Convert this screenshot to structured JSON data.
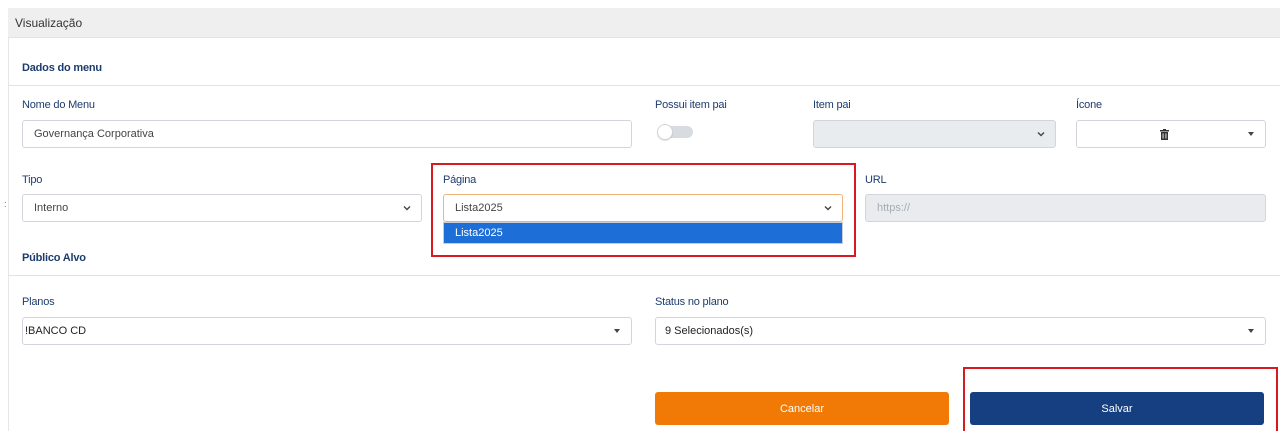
{
  "panel": {
    "title": "Visualização"
  },
  "menu_section": {
    "title": "Dados do menu",
    "nome": {
      "label": "Nome do Menu",
      "value": "Governança Corporativa"
    },
    "possui_item_pai": {
      "label": "Possui item pai",
      "checked": false
    },
    "item_pai": {
      "label": "Item pai",
      "value": ""
    },
    "icone": {
      "label": "Ícone",
      "icon": "trash-icon"
    },
    "tipo": {
      "label": "Tipo",
      "value": "Interno"
    },
    "pagina": {
      "label": "Página",
      "value": "Lista2025",
      "options": [
        "Lista2025"
      ]
    },
    "url": {
      "label": "URL",
      "placeholder": "https://"
    }
  },
  "publico_section": {
    "title": "Público Alvo",
    "planos": {
      "label": "Planos",
      "value": "!BANCO CD"
    },
    "status": {
      "label": "Status no plano",
      "value": "9 Selecionados(s)"
    }
  },
  "actions": {
    "cancel_label": "Cancelar",
    "save_label": "Salvar"
  },
  "colors": {
    "accent_navy": "#153f80",
    "cancel_orange": "#f07a05",
    "highlight_red": "#d71920",
    "option_blue": "#1e6ed8"
  }
}
